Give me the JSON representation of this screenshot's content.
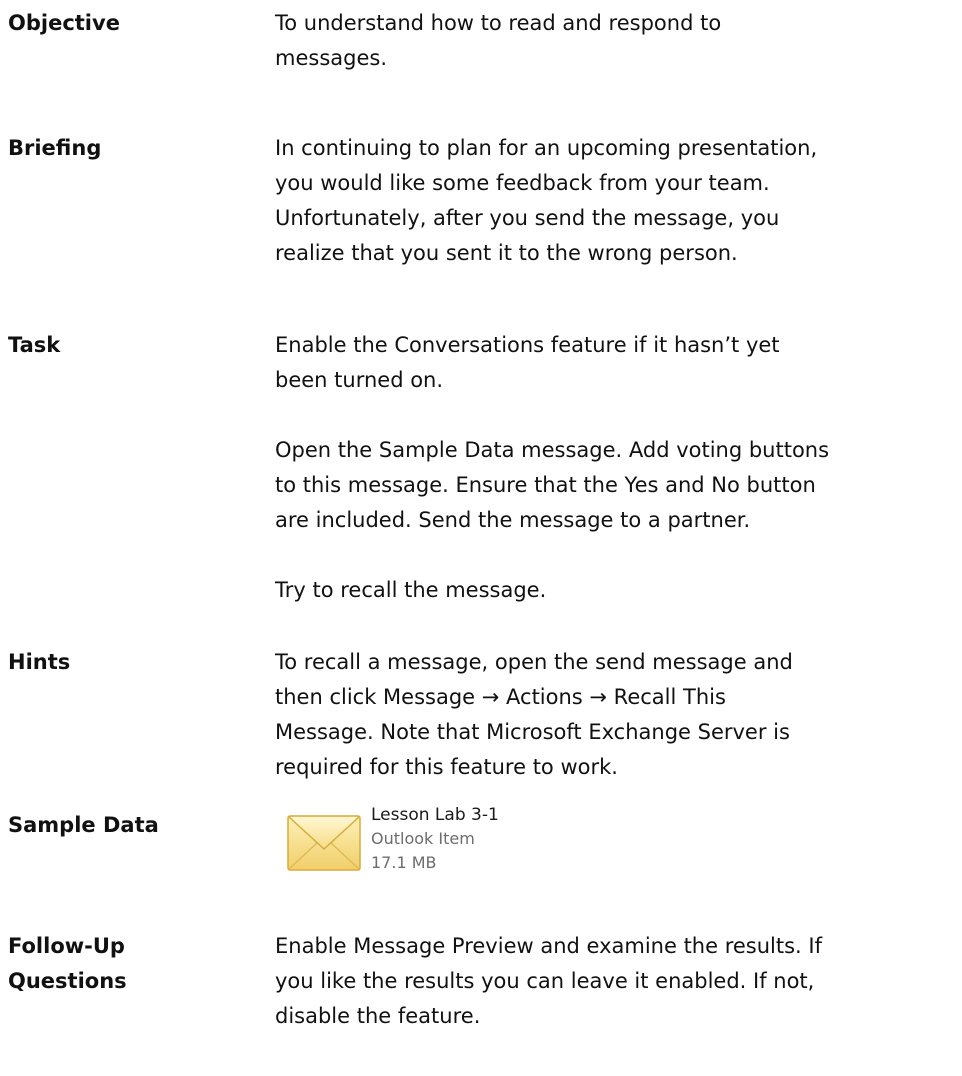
{
  "sections": [
    {
      "label": "Objective",
      "paragraphs": [
        "To understand how to read and respond to\nmessages."
      ]
    },
    {
      "label": "Briefing",
      "paragraphs": [
        "In continuing to plan for an upcoming presentation,\nyou would like some feedback from your team.\nUnfortunately, after you send the message, you\nrealize that you sent it to the wrong person."
      ]
    },
    {
      "label": "Task",
      "paragraphs": [
        "Enable the Conversations feature if it hasn’t yet\nbeen turned on.",
        "Open the Sample Data message. Add voting buttons\nto this message. Ensure that the Yes and No button\nare included. Send the message to a partner.",
        "Try to recall the message."
      ]
    },
    {
      "label": "Hints",
      "paragraphs": [
        "To recall a message, open the send message and\nthen click Message → Actions → Recall This\nMessage. Note that Microsoft Exchange Server is\nrequired for this feature to work."
      ]
    },
    {
      "label": "Sample Data",
      "file": {
        "name": "Lesson Lab 3-1",
        "type": "Outlook Item",
        "size": "17.1 MB",
        "icon": "envelope-icon"
      }
    },
    {
      "label": "Follow-Up\nQuestions",
      "paragraphs": [
        "Enable Message Preview and examine the results. If\nyou like the results you can leave it enabled. If not,\ndisable the feature."
      ]
    }
  ]
}
